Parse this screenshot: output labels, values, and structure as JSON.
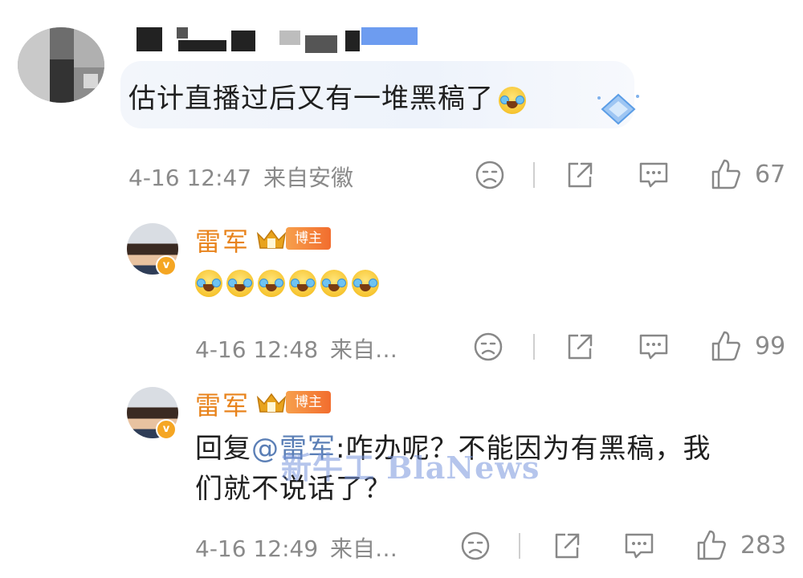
{
  "comments": [
    {
      "text": "估计直播过后又有一堆黑稿了",
      "emoji": "laugh-cry-emoji",
      "timestamp": "4-16 12:47",
      "source": "来自安徽",
      "likes": "67"
    }
  ],
  "replies": [
    {
      "username": "雷军",
      "badge": "博主",
      "emojis": [
        "laugh-cry-emoji",
        "laugh-cry-emoji",
        "laugh-cry-emoji",
        "laugh-cry-emoji",
        "laugh-cry-emoji",
        "laugh-cry-emoji"
      ],
      "timestamp": "4-16 12:48",
      "source": "来自…",
      "likes": "99"
    },
    {
      "username": "雷军",
      "badge": "博主",
      "reply_prefix": "回复",
      "mention": "@雷军",
      "text_line1": ":咋办呢？不能因为有黑稿，我",
      "text_line2": "们就不说话了？",
      "timestamp": "4-16 12:49",
      "source": "来自…",
      "likes": "283"
    }
  ],
  "watermark": "新牛工 BlaNews",
  "colors": {
    "username": "#e8831c",
    "mention": "#5b7fb6",
    "meta": "#8a8a8a"
  },
  "icons": [
    "dislike-face-icon",
    "share-icon",
    "comment-icon",
    "like-thumb-icon",
    "verified-badge-icon",
    "crown-icon"
  ]
}
